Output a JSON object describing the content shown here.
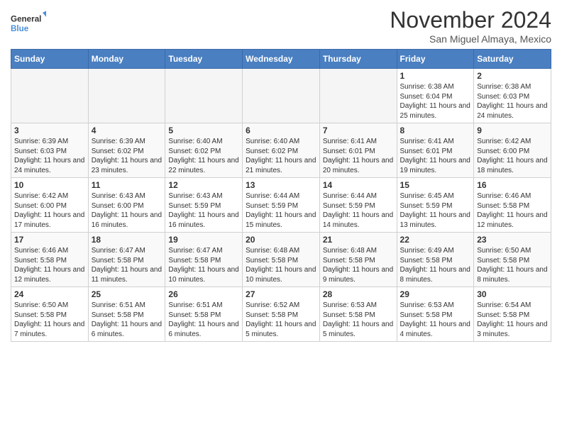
{
  "header": {
    "logo_line1": "General",
    "logo_line2": "Blue",
    "month": "November 2024",
    "location": "San Miguel Almaya, Mexico"
  },
  "days_of_week": [
    "Sunday",
    "Monday",
    "Tuesday",
    "Wednesday",
    "Thursday",
    "Friday",
    "Saturday"
  ],
  "weeks": [
    [
      {
        "day": "",
        "info": ""
      },
      {
        "day": "",
        "info": ""
      },
      {
        "day": "",
        "info": ""
      },
      {
        "day": "",
        "info": ""
      },
      {
        "day": "",
        "info": ""
      },
      {
        "day": "1",
        "info": "Sunrise: 6:38 AM\nSunset: 6:04 PM\nDaylight: 11 hours and 25 minutes."
      },
      {
        "day": "2",
        "info": "Sunrise: 6:38 AM\nSunset: 6:03 PM\nDaylight: 11 hours and 24 minutes."
      }
    ],
    [
      {
        "day": "3",
        "info": "Sunrise: 6:39 AM\nSunset: 6:03 PM\nDaylight: 11 hours and 24 minutes."
      },
      {
        "day": "4",
        "info": "Sunrise: 6:39 AM\nSunset: 6:02 PM\nDaylight: 11 hours and 23 minutes."
      },
      {
        "day": "5",
        "info": "Sunrise: 6:40 AM\nSunset: 6:02 PM\nDaylight: 11 hours and 22 minutes."
      },
      {
        "day": "6",
        "info": "Sunrise: 6:40 AM\nSunset: 6:02 PM\nDaylight: 11 hours and 21 minutes."
      },
      {
        "day": "7",
        "info": "Sunrise: 6:41 AM\nSunset: 6:01 PM\nDaylight: 11 hours and 20 minutes."
      },
      {
        "day": "8",
        "info": "Sunrise: 6:41 AM\nSunset: 6:01 PM\nDaylight: 11 hours and 19 minutes."
      },
      {
        "day": "9",
        "info": "Sunrise: 6:42 AM\nSunset: 6:00 PM\nDaylight: 11 hours and 18 minutes."
      }
    ],
    [
      {
        "day": "10",
        "info": "Sunrise: 6:42 AM\nSunset: 6:00 PM\nDaylight: 11 hours and 17 minutes."
      },
      {
        "day": "11",
        "info": "Sunrise: 6:43 AM\nSunset: 6:00 PM\nDaylight: 11 hours and 16 minutes."
      },
      {
        "day": "12",
        "info": "Sunrise: 6:43 AM\nSunset: 5:59 PM\nDaylight: 11 hours and 16 minutes."
      },
      {
        "day": "13",
        "info": "Sunrise: 6:44 AM\nSunset: 5:59 PM\nDaylight: 11 hours and 15 minutes."
      },
      {
        "day": "14",
        "info": "Sunrise: 6:44 AM\nSunset: 5:59 PM\nDaylight: 11 hours and 14 minutes."
      },
      {
        "day": "15",
        "info": "Sunrise: 6:45 AM\nSunset: 5:59 PM\nDaylight: 11 hours and 13 minutes."
      },
      {
        "day": "16",
        "info": "Sunrise: 6:46 AM\nSunset: 5:58 PM\nDaylight: 11 hours and 12 minutes."
      }
    ],
    [
      {
        "day": "17",
        "info": "Sunrise: 6:46 AM\nSunset: 5:58 PM\nDaylight: 11 hours and 12 minutes."
      },
      {
        "day": "18",
        "info": "Sunrise: 6:47 AM\nSunset: 5:58 PM\nDaylight: 11 hours and 11 minutes."
      },
      {
        "day": "19",
        "info": "Sunrise: 6:47 AM\nSunset: 5:58 PM\nDaylight: 11 hours and 10 minutes."
      },
      {
        "day": "20",
        "info": "Sunrise: 6:48 AM\nSunset: 5:58 PM\nDaylight: 11 hours and 10 minutes."
      },
      {
        "day": "21",
        "info": "Sunrise: 6:48 AM\nSunset: 5:58 PM\nDaylight: 11 hours and 9 minutes."
      },
      {
        "day": "22",
        "info": "Sunrise: 6:49 AM\nSunset: 5:58 PM\nDaylight: 11 hours and 8 minutes."
      },
      {
        "day": "23",
        "info": "Sunrise: 6:50 AM\nSunset: 5:58 PM\nDaylight: 11 hours and 8 minutes."
      }
    ],
    [
      {
        "day": "24",
        "info": "Sunrise: 6:50 AM\nSunset: 5:58 PM\nDaylight: 11 hours and 7 minutes."
      },
      {
        "day": "25",
        "info": "Sunrise: 6:51 AM\nSunset: 5:58 PM\nDaylight: 11 hours and 6 minutes."
      },
      {
        "day": "26",
        "info": "Sunrise: 6:51 AM\nSunset: 5:58 PM\nDaylight: 11 hours and 6 minutes."
      },
      {
        "day": "27",
        "info": "Sunrise: 6:52 AM\nSunset: 5:58 PM\nDaylight: 11 hours and 5 minutes."
      },
      {
        "day": "28",
        "info": "Sunrise: 6:53 AM\nSunset: 5:58 PM\nDaylight: 11 hours and 5 minutes."
      },
      {
        "day": "29",
        "info": "Sunrise: 6:53 AM\nSunset: 5:58 PM\nDaylight: 11 hours and 4 minutes."
      },
      {
        "day": "30",
        "info": "Sunrise: 6:54 AM\nSunset: 5:58 PM\nDaylight: 11 hours and 3 minutes."
      }
    ]
  ]
}
